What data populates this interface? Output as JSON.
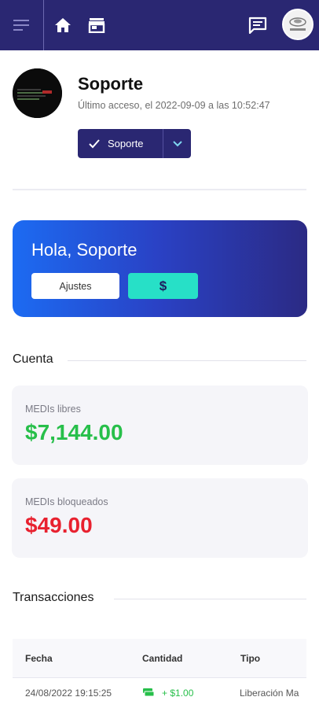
{
  "topbar": {
    "icons": [
      "menu-icon",
      "home-icon",
      "store-icon",
      "chat-icon"
    ],
    "bg_color": "#2a2772"
  },
  "profile": {
    "name": "Soporte",
    "last_access": "Último acceso, el 2022-09-09 a las 10:52:47",
    "role_button_label": "Soporte"
  },
  "banner": {
    "greeting": "Hola, Soporte",
    "settings_label": "Ajustes",
    "currency_label": "$"
  },
  "account": {
    "section_title": "Cuenta",
    "free_label": "MEDIs libres",
    "free_value": "$7,144.00",
    "free_color": "#27bf4a",
    "locked_label": "MEDIs bloqueados",
    "locked_value": "$49.00",
    "locked_color": "#e8212f"
  },
  "transactions": {
    "section_title": "Transacciones",
    "columns": [
      "Fecha",
      "Cantidad",
      "Tipo"
    ],
    "rows": [
      {
        "date": "24/08/2022 19:15:25",
        "amount": "+ $1.00",
        "type": "Liberación Ma"
      }
    ],
    "amount_color": "#27bf4a"
  }
}
